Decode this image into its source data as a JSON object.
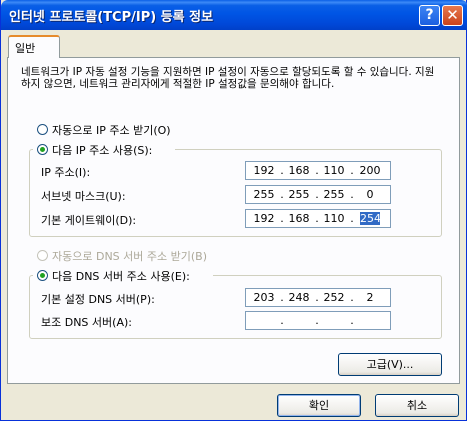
{
  "window": {
    "title": "인터넷 프로토콜(TCP/IP) 등록 정보",
    "help_label": "?",
    "close_label": "✕"
  },
  "tab": {
    "label": "일반"
  },
  "description": "네트워크가 IP 자동 설정 기능을 지원하면 IP 설정이 자동으로 할당되도록 할 수 있습니다. 지원하지 않으면, 네트워크 관리자에게 적절한 IP 설정값을 문의해야 합니다.",
  "ip_options": {
    "auto_label": "자동으로 IP 주소 받기(O)",
    "manual_label": "다음 IP 주소 사용(S):",
    "selected": "manual"
  },
  "ip_fields": [
    {
      "label": "IP 주소(I):",
      "octets": [
        "192",
        "168",
        "110",
        "200"
      ]
    },
    {
      "label": "서브넷 마스크(U):",
      "octets": [
        "255",
        "255",
        "255",
        "0"
      ]
    },
    {
      "label": "기본 게이트웨이(D):",
      "octets": [
        "192",
        "168",
        "110",
        "254"
      ],
      "selected_octet": 3
    }
  ],
  "dns_options": {
    "auto_label": "자동으로 DNS 서버 주소 받기(B)",
    "manual_label": "다음 DNS 서버 주소 사용(E):",
    "selected": "manual"
  },
  "dns_fields": [
    {
      "label": "기본 설정 DNS 서버(P):",
      "octets": [
        "203",
        "248",
        "252",
        "2"
      ]
    },
    {
      "label": "보조 DNS 서버(A):",
      "octets": [
        "",
        "",
        "",
        ""
      ]
    }
  ],
  "buttons": {
    "advanced": "고급(V)...",
    "ok": "확인",
    "cancel": "취소"
  },
  "colors": {
    "titlebar": "#0055e5",
    "selection": "#316ac5",
    "radio_dot": "#21a121",
    "tab_highlight": "#e68b2c"
  }
}
